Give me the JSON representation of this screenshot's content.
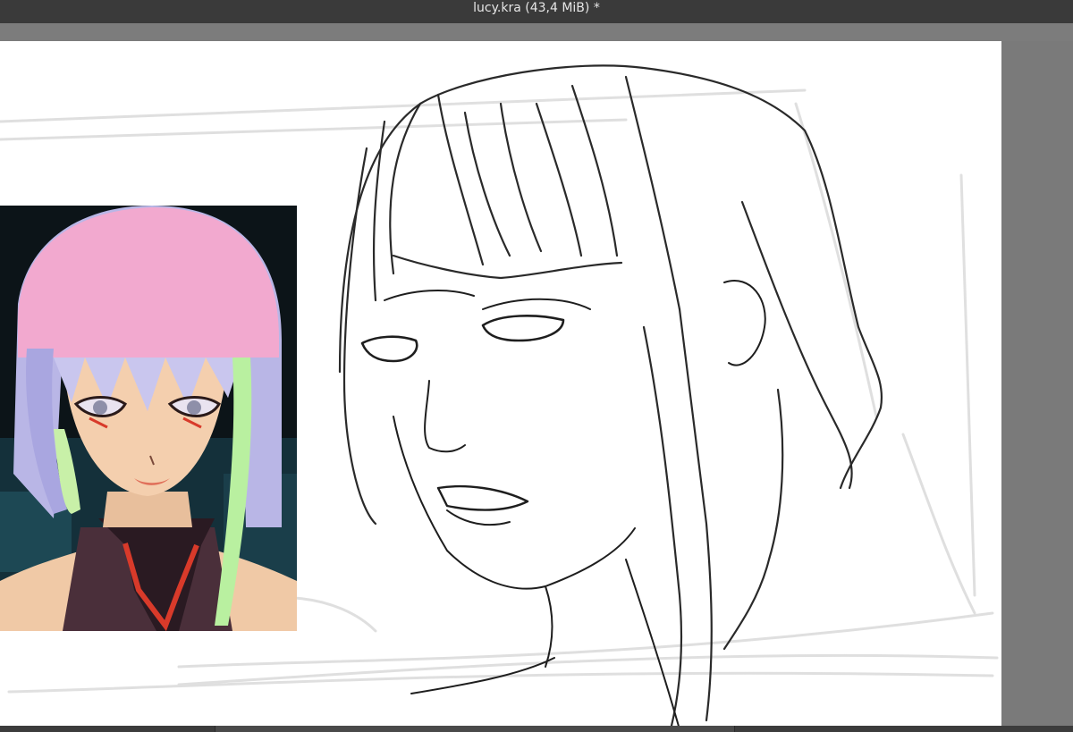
{
  "window": {
    "title": "lucy.kra (43,4 MiB) *"
  },
  "canvas": {
    "background": "#ffffff",
    "layers": {
      "reference_image": "reference-anime-portrait",
      "sketch": "pencil-line-sketch"
    }
  },
  "colors": {
    "titlebar": "#3a3a3a",
    "workspace": "#7a7a7a",
    "hair_pink": "#f2a9cf",
    "hair_lilac": "#b9b6e6",
    "hair_green": "#b9f0a0",
    "skin": "#f4cfae",
    "accent_red": "#d83a2a"
  }
}
